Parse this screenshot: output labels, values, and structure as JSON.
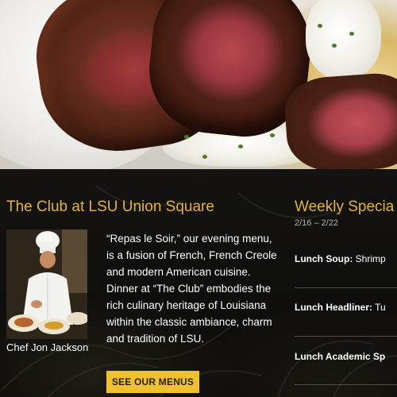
{
  "club": {
    "title": "The Club at LSU Union Square",
    "intro": "“Repas le Soir,” our evening menu, is a fusion of French, French Creole and modern American cuisine. Dinner at “The Club” embodies the rich culinary heritage of Louisiana within the classic ambiance, charm and tradition of LSU.",
    "chef_caption": "Chef Jon Jackson",
    "menus_button": "SEE OUR MENUS"
  },
  "weekly": {
    "title": "Weekly Specia",
    "dates": "2/16 – 2/22",
    "items": [
      {
        "label": "Lunch Soup:",
        "value": " Shrimp"
      },
      {
        "label": "Lunch Headliner:",
        "value": " Tu"
      },
      {
        "label": "Lunch Academic Sp",
        "value": ""
      }
    ]
  },
  "colors": {
    "accent_gold": "#e2b43a",
    "button_yellow": "#efc02f",
    "background": "#0c0c0a"
  }
}
